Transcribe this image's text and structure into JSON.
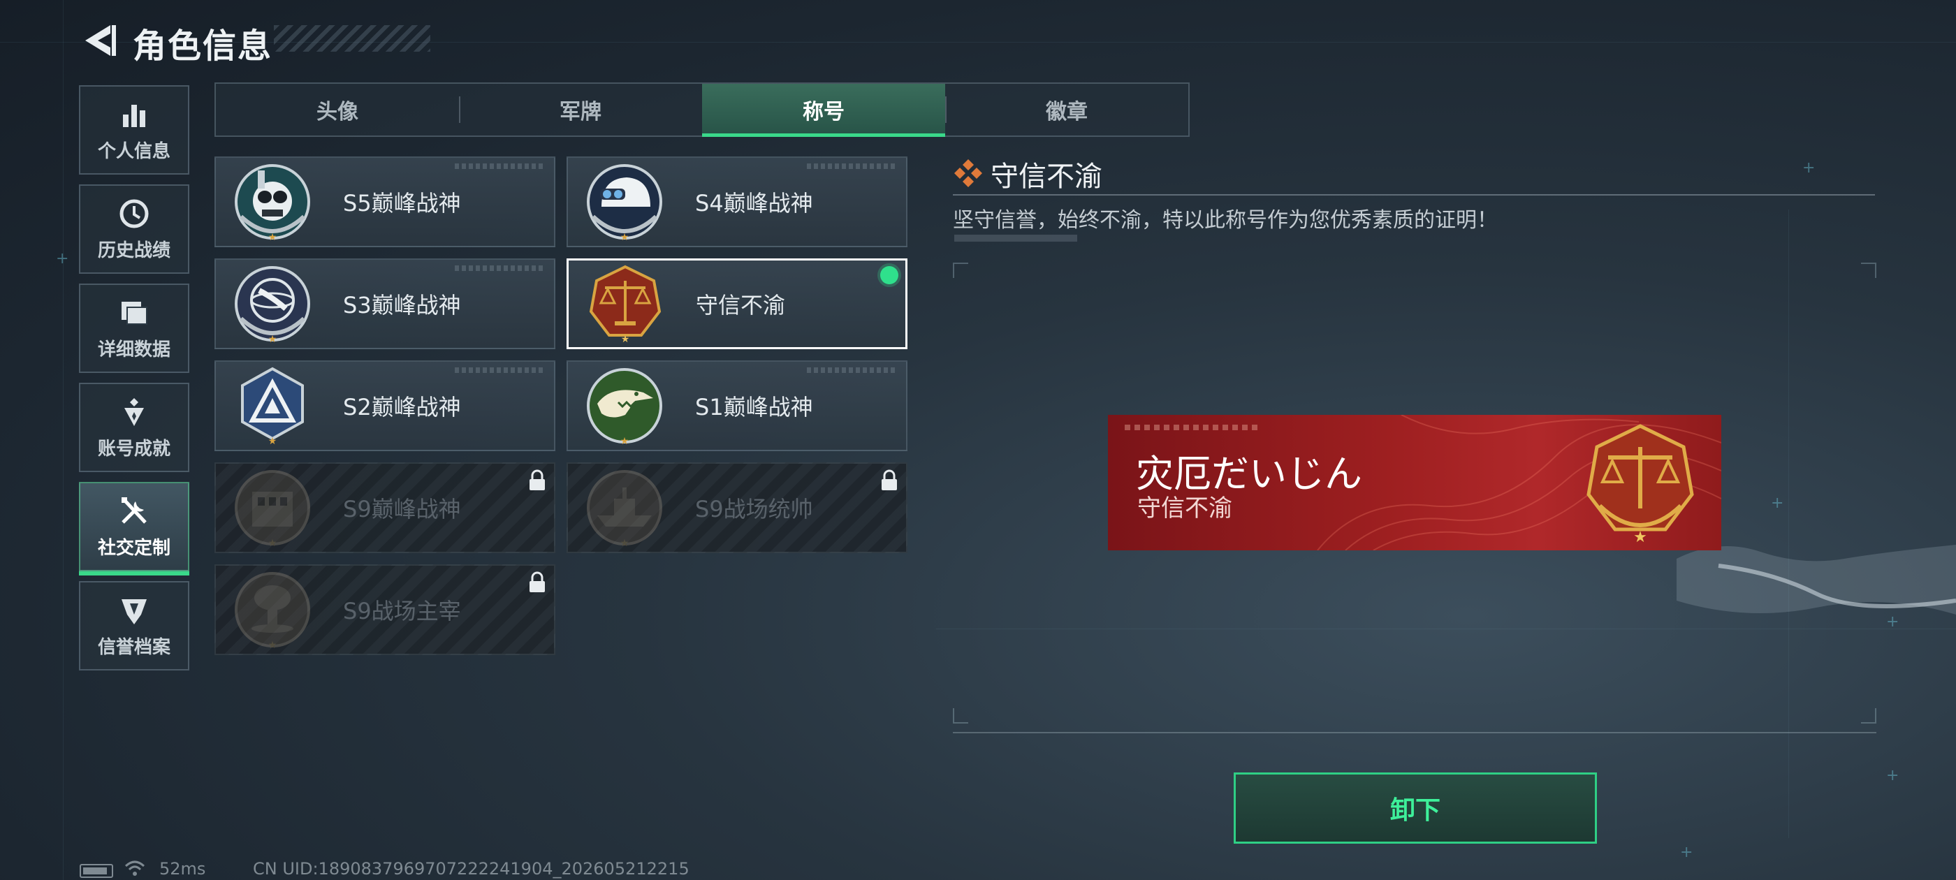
{
  "header": {
    "title": "角色信息"
  },
  "sidebar": {
    "items": [
      {
        "label": "个人信息",
        "icon": "bar-chart-icon",
        "active": false
      },
      {
        "label": "历史战绩",
        "icon": "clock-icon",
        "active": false
      },
      {
        "label": "详细数据",
        "icon": "folder-icon",
        "active": false
      },
      {
        "label": "账号成就",
        "icon": "achievement-icon",
        "active": false
      },
      {
        "label": "社交定制",
        "icon": "tools-icon",
        "active": true
      },
      {
        "label": "信誉档案",
        "icon": "shield-icon",
        "active": false
      }
    ]
  },
  "tabs": [
    {
      "label": "头像",
      "active": false
    },
    {
      "label": "军牌",
      "active": false
    },
    {
      "label": "称号",
      "active": true
    },
    {
      "label": "徽章",
      "active": false
    }
  ],
  "titles": [
    {
      "name": "S5巅峰战神",
      "locked": false,
      "selected": false,
      "medal": "diver-skull-medal"
    },
    {
      "name": "S4巅峰战神",
      "locked": false,
      "selected": false,
      "medal": "helmet-medal"
    },
    {
      "name": "S3巅峰战神",
      "locked": false,
      "selected": false,
      "medal": "globe-medal"
    },
    {
      "name": "守信不渝",
      "locked": false,
      "selected": true,
      "equipped": true,
      "medal": "scales-medal"
    },
    {
      "name": "S2巅峰战神",
      "locked": false,
      "selected": false,
      "medal": "triangle-medal"
    },
    {
      "name": "S1巅峰战神",
      "locked": false,
      "selected": false,
      "medal": "crocodile-medal"
    },
    {
      "name": "S9巅峰战神",
      "locked": true,
      "selected": false,
      "medal": "building-medal"
    },
    {
      "name": "S9战场统帅",
      "locked": true,
      "selected": false,
      "medal": "warship-medal"
    },
    {
      "name": "S9战场主宰",
      "locked": true,
      "selected": false,
      "medal": "mushroom-cloud-medal"
    }
  ],
  "detail": {
    "title": "守信不渝",
    "description": "坚守信誉，始终不渝，特以此称号作为您优秀素质的证明！"
  },
  "banner": {
    "player_name": "灾厄だいじん",
    "title": "守信不渝"
  },
  "actions": {
    "unequip_label": "卸下"
  },
  "footer": {
    "ping": "52ms",
    "uid": "CN UID:1890837969707222241904_202605212215"
  },
  "colors": {
    "accent_green": "#3ad98a",
    "banner_red": "#9d1f20",
    "medal_gold": "#d9a441"
  }
}
